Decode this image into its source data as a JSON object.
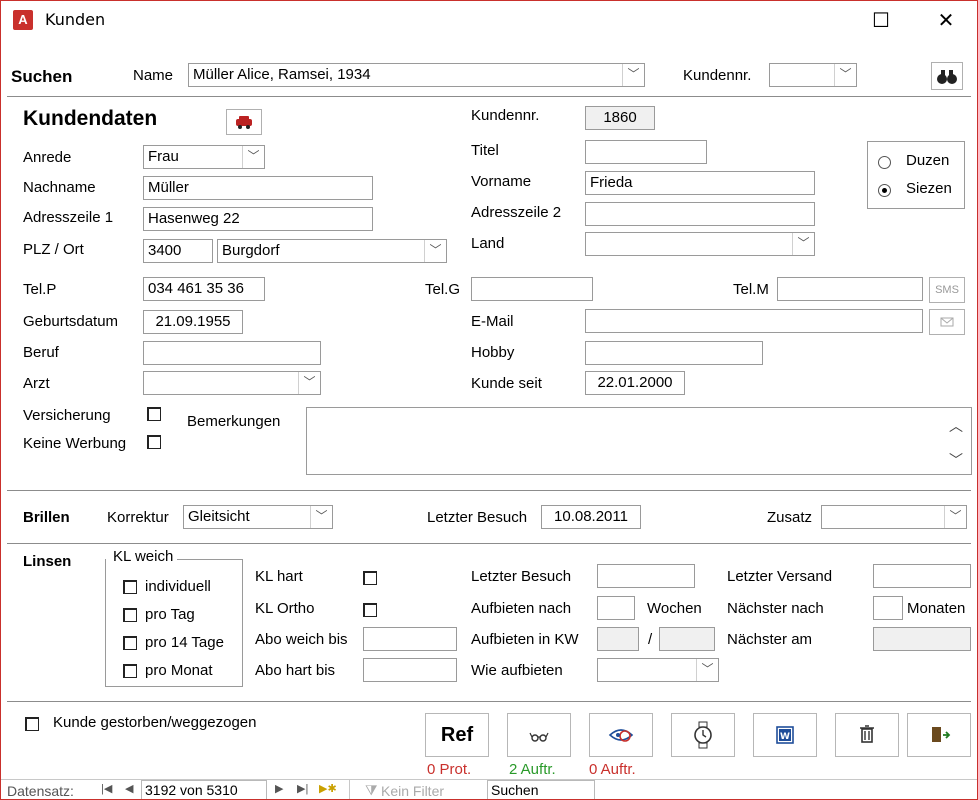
{
  "window": {
    "title": "Kunden",
    "app_icon_letter": "A"
  },
  "search": {
    "heading": "Suchen",
    "name_label": "Name",
    "name_value": "Müller Alice, Ramsei, 1934",
    "kundennr_label": "Kundennr.",
    "kundennr_value": ""
  },
  "kunde": {
    "heading": "Kundendaten",
    "kundennr_label": "Kundennr.",
    "kundennr_value": "1860",
    "anrede_label": "Anrede",
    "anrede_value": "Frau",
    "titel_label": "Titel",
    "titel_value": "",
    "nachname_label": "Nachname",
    "nachname_value": "Müller",
    "vorname_label": "Vorname",
    "vorname_value": "Frieda",
    "adr1_label": "Adresszeile 1",
    "adr1_value": "Hasenweg 22",
    "adr2_label": "Adresszeile 2",
    "adr2_value": "",
    "plzort_label": "PLZ / Ort",
    "plz_value": "3400",
    "ort_value": "Burgdorf",
    "land_label": "Land",
    "land_value": "",
    "telp_label": "Tel.P",
    "telp_value": "034 461 35 36",
    "telg_label": "Tel.G",
    "telg_value": "",
    "telm_label": "Tel.M",
    "telm_value": "",
    "sms_label": "SMS",
    "geb_label": "Geburtsdatum",
    "geb_value": "21.09.1955",
    "email_label": "E-Mail",
    "email_value": "",
    "beruf_label": "Beruf",
    "beruf_value": "",
    "hobby_label": "Hobby",
    "hobby_value": "",
    "arzt_label": "Arzt",
    "arzt_value": "",
    "kundeseit_label": "Kunde seit",
    "kundeseit_value": "22.01.2000",
    "versicherung_label": "Versicherung",
    "keinewerbung_label": "Keine Werbung",
    "bemerkungen_label": "Bemerkungen",
    "bemerkungen_value": "",
    "duzen_label": "Duzen",
    "siezen_label": "Siezen"
  },
  "brillen": {
    "heading": "Brillen",
    "korrektur_label": "Korrektur",
    "korrektur_value": "Gleitsicht",
    "letzter_besuch_label": "Letzter Besuch",
    "letzter_besuch_value": "10.08.2011",
    "zusatz_label": "Zusatz",
    "zusatz_value": ""
  },
  "linsen": {
    "heading": "Linsen",
    "klweich_label": "KL weich",
    "individuell_label": "individuell",
    "protag_label": "pro Tag",
    "pro14_label": "pro 14 Tage",
    "promonat_label": "pro Monat",
    "klhart_label": "KL hart",
    "klortho_label": "KL Ortho",
    "aboweich_label": "Abo weich bis",
    "abohart_label": "Abo hart bis",
    "letzter_besuch_label": "Letzter Besuch",
    "aufbieten_nach_label": "Aufbieten nach",
    "wochen_label": "Wochen",
    "aufbieten_kw_label": "Aufbieten in KW",
    "kw_sep": "/",
    "wie_aufbieten_label": "Wie aufbieten",
    "letzter_versand_label": "Letzter Versand",
    "naechster_nach_label": "Nächster nach",
    "monaten_label": "Monaten",
    "naechster_am_label": "Nächster am"
  },
  "footer": {
    "gestorben_label": "Kunde gestorben/weggezogen",
    "ref_label": "Ref",
    "prot_count": "0 Prot.",
    "auftr_brillen": "2 Auftr.",
    "auftr_linsen": "0 Auftr."
  },
  "nav": {
    "datensatz_label": "Datensatz:",
    "record_text": "3192 von 5310",
    "filter_label": "Kein Filter",
    "search_label": "Suchen"
  }
}
